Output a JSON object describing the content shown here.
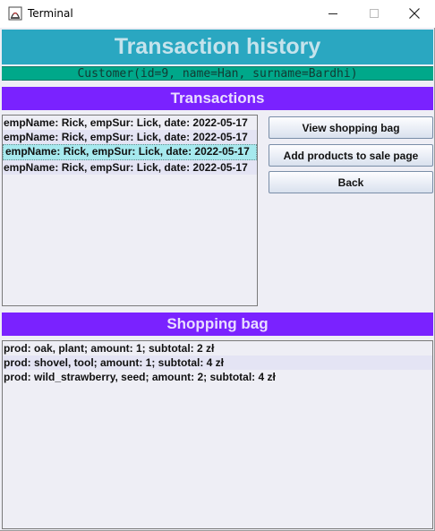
{
  "window": {
    "title": "Terminal",
    "minimize_glyph": "—",
    "maximize_glyph": "☐",
    "close_glyph": "✕"
  },
  "header": {
    "title": "Transaction history",
    "customer": "Customer(id=9, name=Han, surname=Bardhi)"
  },
  "transactions": {
    "title": "Transactions",
    "items": [
      "empName: Rick, empSur: Lick, date: 2022-05-17",
      "empName: Rick, empSur: Lick, date: 2022-05-17",
      "empName: Rick, empSur: Lick, date: 2022-05-17",
      "empName: Rick, empSur: Lick, date: 2022-05-17"
    ],
    "selected_index": 2
  },
  "buttons": {
    "view_shopping_bag": "View shopping bag",
    "add_products": "Add products  to sale page",
    "back": "Back"
  },
  "shopping_bag": {
    "title": "Shopping bag",
    "items": [
      "prod: oak, plant; amount: 1; subtotal: 2 zł",
      "prod: shovel, tool; amount: 1; subtotal: 4 zł",
      "prod: wild_strawberry, seed; amount: 2; subtotal: 4 zł"
    ]
  },
  "colors": {
    "header_bg": "#2aa7c1",
    "customer_bg": "#00a88a",
    "section_bg": "#7a22ff",
    "selected_row": "#a6e9ee"
  },
  "icons": {
    "app": "java-app-icon",
    "minimize": "minimize-icon",
    "maximize": "maximize-icon",
    "close": "close-icon"
  }
}
